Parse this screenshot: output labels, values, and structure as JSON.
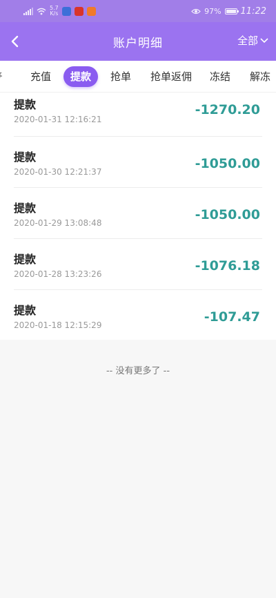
{
  "status_bar": {
    "net_speed_value": "5.7",
    "net_speed_unit": "K/s",
    "battery_percent": "97%",
    "time": "11:22"
  },
  "nav": {
    "title": "账户明细",
    "filter_label": "全部"
  },
  "tabs": [
    {
      "label": "充值"
    },
    {
      "label": "提款",
      "active": true
    },
    {
      "label": "抢单"
    },
    {
      "label": "抢单返佣"
    },
    {
      "label": "冻结"
    },
    {
      "label": "解冻"
    }
  ],
  "records": [
    {
      "type": "提款",
      "time": "2020-01-31 12:16:21",
      "amount": "-1270.20"
    },
    {
      "type": "提款",
      "time": "2020-01-30 12:21:37",
      "amount": "-1050.00"
    },
    {
      "type": "提款",
      "time": "2020-01-29 13:08:48",
      "amount": "-1050.00"
    },
    {
      "type": "提款",
      "time": "2020-01-28 13:23:26",
      "amount": "-1076.18"
    },
    {
      "type": "提款",
      "time": "2020-01-18 12:15:29",
      "amount": "-107.47"
    }
  ],
  "list_footer": "-- 没有更多了 --",
  "colors": {
    "nav_bg": "#9b73f0",
    "active_tab": "#8a5cf0",
    "amount": "#2f9c96"
  },
  "icons": [
    "back-arrow-icon",
    "chevron-down-icon",
    "signal-icon",
    "wifi-icon",
    "eye-icon",
    "battery-icon"
  ]
}
